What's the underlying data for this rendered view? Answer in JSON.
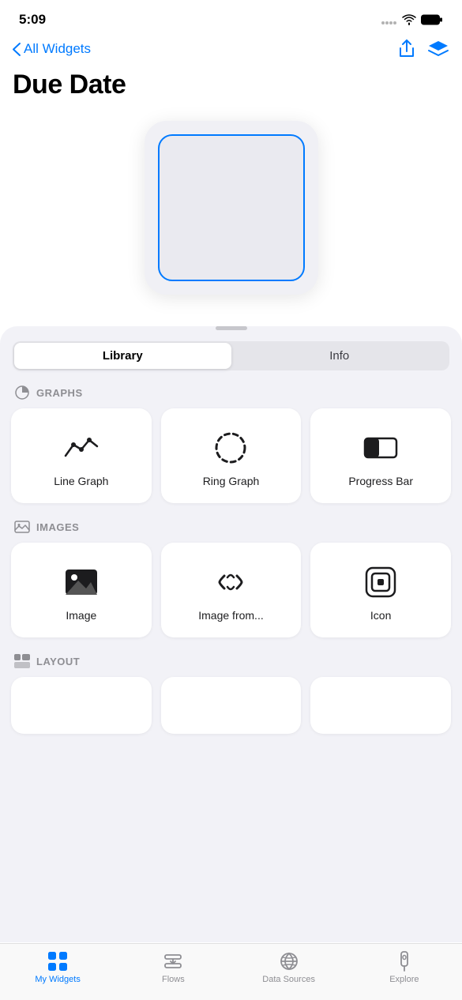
{
  "status": {
    "time": "5:09"
  },
  "nav": {
    "back_label": "All Widgets",
    "title": "Due Date",
    "share_icon": "share-icon",
    "layers_icon": "layers-icon"
  },
  "segment": {
    "library_label": "Library",
    "info_label": "Info",
    "active": "library"
  },
  "graphs_section": {
    "label": "GRAPHS"
  },
  "images_section": {
    "label": "IMAGES"
  },
  "layout_section": {
    "label": "LAYOUT"
  },
  "graph_widgets": [
    {
      "id": "line-graph",
      "label": "Line Graph"
    },
    {
      "id": "ring-graph",
      "label": "Ring Graph"
    },
    {
      "id": "progress-bar",
      "label": "Progress Bar"
    }
  ],
  "image_widgets": [
    {
      "id": "image",
      "label": "Image"
    },
    {
      "id": "image-from",
      "label": "Image from..."
    },
    {
      "id": "icon",
      "label": "Icon"
    }
  ],
  "tabs": [
    {
      "id": "my-widgets",
      "label": "My Widgets",
      "active": true
    },
    {
      "id": "flows",
      "label": "Flows",
      "active": false
    },
    {
      "id": "data-sources",
      "label": "Data Sources",
      "active": false
    },
    {
      "id": "explore",
      "label": "Explore",
      "active": false
    }
  ]
}
